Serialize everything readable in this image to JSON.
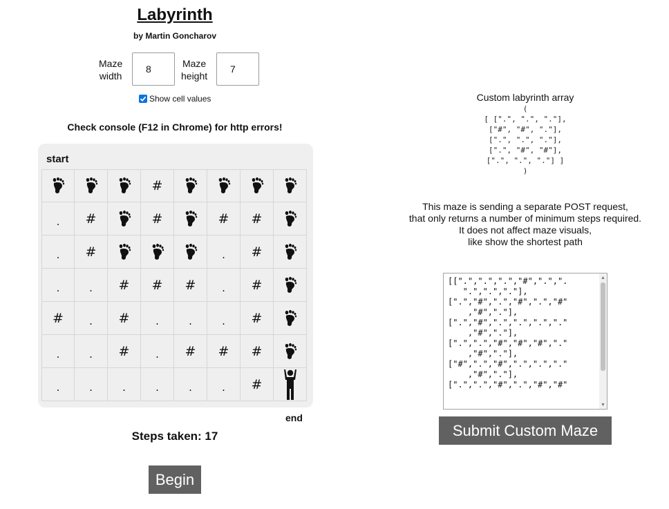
{
  "header": {
    "title": "Labyrinth",
    "author": "by Martin Goncharov"
  },
  "controls": {
    "width_label_1": "Maze",
    "width_label_2": "width",
    "width_value": "8",
    "height_label_1": "Maze",
    "height_label_2": "height",
    "height_value": "7",
    "show_values_label": "Show cell values",
    "show_values_checked": true
  },
  "console_note": "Check console (F12 in Chrome) for http errors!",
  "maze": {
    "start_label": "start",
    "end_label": "end",
    "rows": [
      [
        "foot",
        "foot",
        "foot",
        "#",
        "foot",
        "foot",
        "foot",
        "foot"
      ],
      [
        ".",
        "#",
        "foot",
        "#",
        "foot",
        "#",
        "#",
        "foot"
      ],
      [
        ".",
        "#",
        "foot",
        "foot",
        "foot",
        ".",
        "#",
        "foot"
      ],
      [
        ".",
        ".",
        "#",
        "#",
        "#",
        ".",
        "#",
        "foot"
      ],
      [
        "#",
        ".",
        "#",
        ".",
        ".",
        ".",
        "#",
        "foot"
      ],
      [
        ".",
        ".",
        "#",
        ".",
        "#",
        "#",
        "#",
        "foot"
      ],
      [
        ".",
        ".",
        ".",
        ".",
        ".",
        ".",
        "#",
        "person"
      ]
    ]
  },
  "steps_text": "Steps taken: 17",
  "begin_label": "Begin",
  "custom": {
    "title": "Custom labyrinth array",
    "array_lines": [
      "(",
      "[ [\".\", \".\", \".\"],",
      "[\"#\", \"#\", \".\"],",
      "[\".\", \".\", \".\"],",
      "[\".\", \"#\", \"#\"],",
      "[\".\", \".\", \".\"] ]",
      ")"
    ],
    "post_note_lines": [
      "This maze is sending a separate POST request,",
      "that only returns a number of minimum steps required.",
      "It does not affect maze visuals,",
      "like show the shortest path"
    ],
    "textarea_value": "[[\".\",\".\",\".\",\"#\",\".\",\".\n   \".\",\".\",\".\"],\n[\".\",\"#\",\".\",\"#\",\".\",\"#\"\n    ,\"#\",\".\"],\n[\".\",\"#\",\".\",\".\",\".\",\".\"\n    ,\"#\",\".\"],\n[\".\",\".\",\"#\",\"#\",\"#\",\".\"\n    ,\"#\",\".\"],\n[\"#\",\".\",\"#\",\".\",\".\",\".\"\n    ,\"#\",\".\"],\n[\".\",\".\",\"#\",\".\",\"#\",\"#\"",
    "submit_label": "Submit Custom Maze"
  },
  "icons": {
    "foot": "footprint-icon",
    "person": "person-icon",
    "check": "checkmark-icon"
  }
}
